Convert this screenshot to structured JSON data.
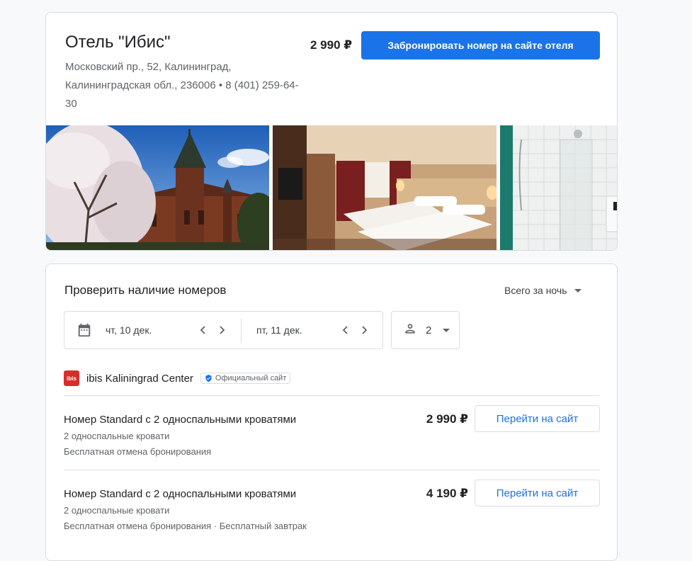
{
  "hotel": {
    "title": "Отель \"Ибис\"",
    "address": "Московский пр., 52, Калининград, Калининградская обл., 236006 • 8 (401) 259-64-30",
    "price": "2 990 ₽",
    "book_label": "Забронировать номер на сайте отеля"
  },
  "availability": {
    "title": "Проверить наличие номеров",
    "price_mode": "Всего за ночь",
    "checkin": "чт, 10 дек.",
    "checkout": "пт, 11 дек.",
    "guests": "2"
  },
  "partner": {
    "logo_text": "ibis",
    "name": "ibis Kaliningrad Center",
    "badge": "Официальный сайт"
  },
  "rooms": [
    {
      "name": "Номер Standard с 2 односпальными кроватями",
      "beds": "2 односпальные кровати",
      "policy": "Бесплатная отмена бронирования",
      "price": "2 990 ₽",
      "button": "Перейти на сайт"
    },
    {
      "name": "Номер Standard с 2 односпальными кроватями",
      "beds": "2 односпальные кровати",
      "policy": "Бесплатная отмена бронирования · Бесплатный завтрак",
      "price": "4 190 ₽",
      "button": "Перейти на сайт"
    }
  ],
  "colors": {
    "accent": "#1a73e8",
    "brand_ibis": "#d72e2a"
  }
}
